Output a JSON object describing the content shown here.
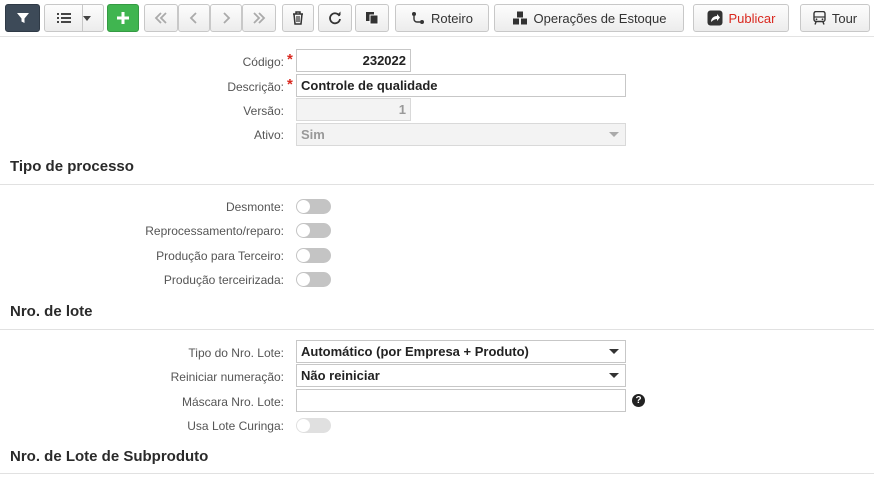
{
  "toolbar": {
    "roteiro": "Roteiro",
    "operacoes": "Operações de Estoque",
    "publicar": "Publicar",
    "tour": "Tour"
  },
  "form": {
    "codigo": {
      "label": "Código:",
      "value": "232022"
    },
    "descricao": {
      "label": "Descrição:",
      "value": "Controle de qualidade"
    },
    "versao": {
      "label": "Versão:",
      "value": "1"
    },
    "ativo": {
      "label": "Ativo:",
      "value": "Sim"
    }
  },
  "sections": {
    "tipo_processo": "Tipo de processo",
    "nro_lote": "Nro. de lote",
    "lote_subproduto": "Nro. de Lote de Subproduto"
  },
  "tipo_processo": {
    "desmonte": "Desmonte:",
    "reprocessamento": "Reprocessamento/reparo:",
    "producao_terceiro": "Produção para Terceiro:",
    "producao_terceirizada": "Produção terceirizada:"
  },
  "lote": {
    "tipo": {
      "label": "Tipo do Nro. Lote:",
      "value": "Automático (por Empresa + Produto)"
    },
    "reiniciar": {
      "label": "Reiniciar numeração:",
      "value": "Não reiniciar"
    },
    "mascara": {
      "label": "Máscara Nro. Lote:",
      "value": ""
    },
    "curinga": {
      "label": "Usa Lote Curinga:"
    }
  },
  "icons": {
    "help": "?"
  },
  "colors": {
    "publicar": "#d9281f",
    "add": "#40b550",
    "filter": "#3d4a58"
  }
}
